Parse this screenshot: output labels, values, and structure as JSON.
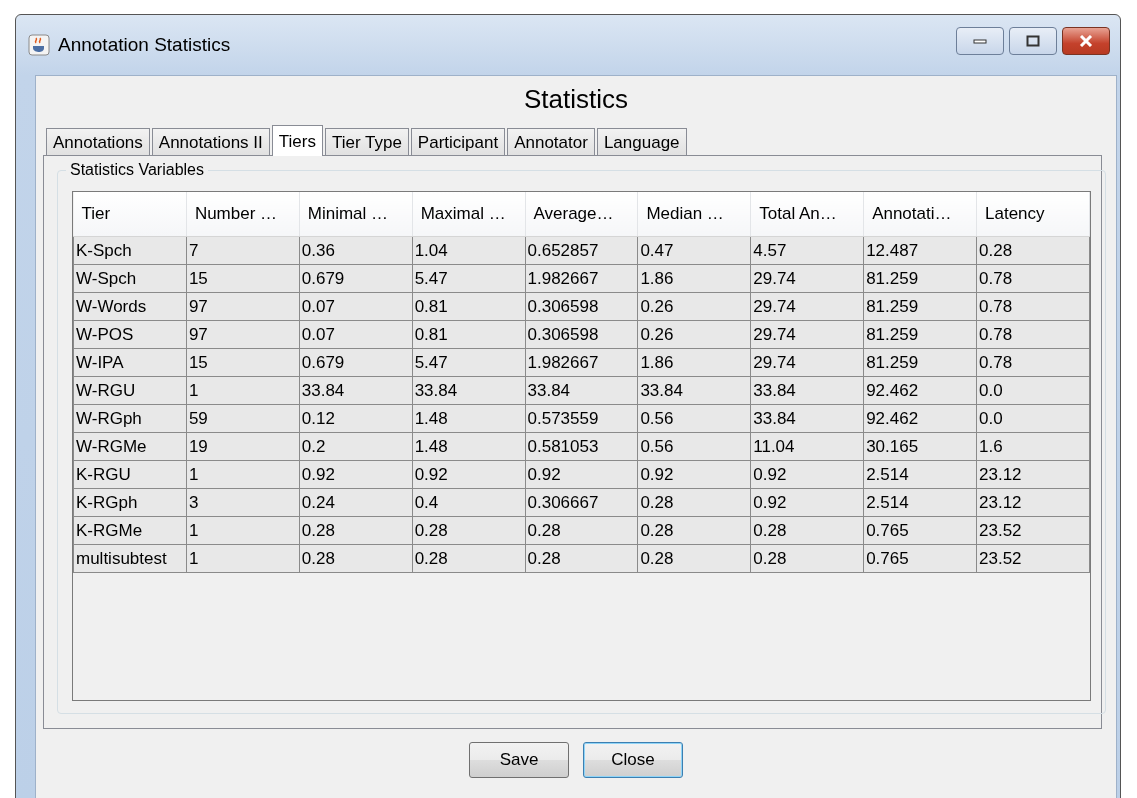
{
  "window": {
    "title": "Annotation Statistics"
  },
  "heading": "Statistics",
  "tabs": [
    {
      "label": "Annotations",
      "selected": false
    },
    {
      "label": "Annotations II",
      "selected": false
    },
    {
      "label": "Tiers",
      "selected": true
    },
    {
      "label": "Tier Type",
      "selected": false
    },
    {
      "label": "Participant",
      "selected": false
    },
    {
      "label": "Annotator",
      "selected": false
    },
    {
      "label": "Language",
      "selected": false
    }
  ],
  "group_title": "Statistics Variables",
  "table": {
    "columns": [
      "Tier",
      "Number …",
      "Minimal …",
      "Maximal …",
      "Average…",
      "Median …",
      "Total An…",
      "Annotati…",
      "Latency"
    ],
    "rows": [
      [
        "K-Spch",
        "7",
        "0.36",
        "1.04",
        "0.652857",
        "0.47",
        "4.57",
        "12.487",
        "0.28"
      ],
      [
        "W-Spch",
        "15",
        "0.679",
        "5.47",
        "1.982667",
        "1.86",
        "29.74",
        "81.259",
        "0.78"
      ],
      [
        "W-Words",
        "97",
        "0.07",
        "0.81",
        "0.306598",
        "0.26",
        "29.74",
        "81.259",
        "0.78"
      ],
      [
        "W-POS",
        "97",
        "0.07",
        "0.81",
        "0.306598",
        "0.26",
        "29.74",
        "81.259",
        "0.78"
      ],
      [
        "W-IPA",
        "15",
        "0.679",
        "5.47",
        "1.982667",
        "1.86",
        "29.74",
        "81.259",
        "0.78"
      ],
      [
        "W-RGU",
        "1",
        "33.84",
        "33.84",
        "33.84",
        "33.84",
        "33.84",
        "92.462",
        "0.0"
      ],
      [
        "W-RGph",
        "59",
        "0.12",
        "1.48",
        "0.573559",
        "0.56",
        "33.84",
        "92.462",
        "0.0"
      ],
      [
        "W-RGMe",
        "19",
        "0.2",
        "1.48",
        "0.581053",
        "0.56",
        "11.04",
        "30.165",
        "1.6"
      ],
      [
        "K-RGU",
        "1",
        "0.92",
        "0.92",
        "0.92",
        "0.92",
        "0.92",
        "2.514",
        "23.12"
      ],
      [
        "K-RGph",
        "3",
        "0.24",
        "0.4",
        "0.306667",
        "0.28",
        "0.92",
        "2.514",
        "23.12"
      ],
      [
        "K-RGMe",
        "1",
        "0.28",
        "0.28",
        "0.28",
        "0.28",
        "0.28",
        "0.765",
        "23.52"
      ],
      [
        "multisubtest",
        "1",
        "0.28",
        "0.28",
        "0.28",
        "0.28",
        "0.28",
        "0.765",
        "23.52"
      ]
    ]
  },
  "buttons": [
    {
      "label": "Save",
      "focused": false
    },
    {
      "label": "Close",
      "focused": true
    }
  ]
}
